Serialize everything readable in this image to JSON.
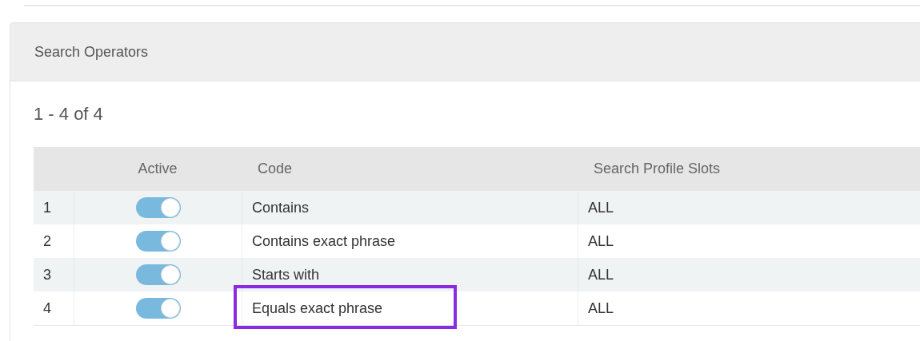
{
  "panel": {
    "title": "Search Operators",
    "count": "1 - 4 of 4"
  },
  "table": {
    "columns": [
      "Active",
      "Code",
      "Search Profile Slots"
    ],
    "rows": [
      {
        "index": "1",
        "active": true,
        "code": "Contains",
        "slots": "ALL",
        "highlighted": false
      },
      {
        "index": "2",
        "active": true,
        "code": "Contains exact phrase",
        "slots": "ALL",
        "highlighted": false
      },
      {
        "index": "3",
        "active": true,
        "code": "Starts with",
        "slots": "ALL",
        "highlighted": false
      },
      {
        "index": "4",
        "active": true,
        "code": "Equals exact phrase",
        "slots": "ALL",
        "highlighted": true
      }
    ]
  }
}
